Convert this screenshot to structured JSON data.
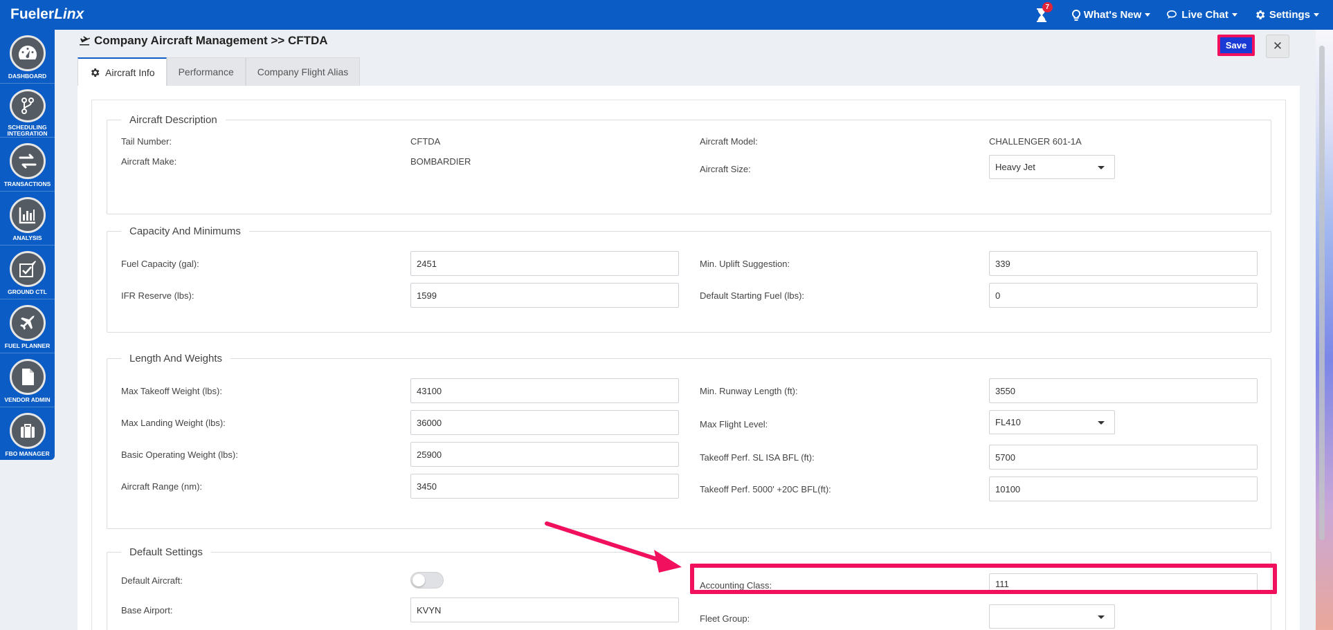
{
  "app": {
    "logo_main": "Fueler",
    "logo_italic": "Linx"
  },
  "topnav": {
    "notifications_count": "7",
    "whats_new": "What's New",
    "live_chat": "Live Chat",
    "settings": "Settings"
  },
  "sidebar": {
    "items": [
      {
        "label": "DASHBOARD",
        "icon": "gauge-icon"
      },
      {
        "label": "SCHEDULING INTEGRATION",
        "icon": "branch-icon"
      },
      {
        "label": "TRANSACTIONS",
        "icon": "exchange-icon"
      },
      {
        "label": "ANALYSIS",
        "icon": "bar-chart-icon"
      },
      {
        "label": "GROUND CTL",
        "icon": "checkbox-plane-icon"
      },
      {
        "label": "FUEL PLANNER",
        "icon": "plane-icon"
      },
      {
        "label": "VENDOR ADMIN",
        "icon": "document-icon"
      },
      {
        "label": "FBO MANAGER",
        "icon": "briefcase-icon"
      }
    ]
  },
  "page": {
    "title": "Company Aircraft Management >> CFTDA",
    "save_label": "Save",
    "close_label": "✕"
  },
  "tabs": [
    {
      "label": "Aircraft Info",
      "active": true
    },
    {
      "label": "Performance",
      "active": false
    },
    {
      "label": "Company Flight Alias",
      "active": false
    }
  ],
  "aircraft_description": {
    "legend": "Aircraft Description",
    "tail_number_label": "Tail Number:",
    "tail_number": "CFTDA",
    "make_label": "Aircraft Make:",
    "make": "BOMBARDIER",
    "model_label": "Aircraft Model:",
    "model": "CHALLENGER 601-1A",
    "size_label": "Aircraft Size:",
    "size": "Heavy Jet"
  },
  "capacity": {
    "legend": "Capacity And Minimums",
    "fuel_capacity_label": "Fuel Capacity (gal):",
    "fuel_capacity": "2451",
    "ifr_reserve_label": "IFR Reserve (lbs):",
    "ifr_reserve": "1599",
    "min_uplift_label": "Min. Uplift Suggestion:",
    "min_uplift": "339",
    "default_starting_fuel_label": "Default Starting Fuel (lbs):",
    "default_starting_fuel": "0"
  },
  "weights": {
    "legend": "Length And Weights",
    "max_takeoff_label": "Max Takeoff Weight (lbs):",
    "max_takeoff": "43100",
    "max_landing_label": "Max Landing Weight (lbs):",
    "max_landing": "36000",
    "basic_operating_label": "Basic Operating Weight (lbs):",
    "basic_operating": "25900",
    "range_label": "Aircraft Range (nm):",
    "range": "3450",
    "min_runway_label": "Min. Runway Length (ft):",
    "min_runway": "3550",
    "max_flight_level_label": "Max Flight Level:",
    "max_flight_level": "FL410",
    "takeoff_sl_label": "Takeoff Perf. SL ISA BFL (ft):",
    "takeoff_sl": "5700",
    "takeoff_5000_label": "Takeoff Perf. 5000' +20C BFL(ft):",
    "takeoff_5000": "10100"
  },
  "defaults": {
    "legend": "Default Settings",
    "default_aircraft_label": "Default Aircraft:",
    "default_aircraft_on": false,
    "base_airport_label": "Base Airport:",
    "base_airport": "KVYN",
    "accounting_class_label": "Accounting Class:",
    "accounting_class": "111",
    "fleet_group_label": "Fleet Group:",
    "fleet_group": ""
  },
  "colors": {
    "brand_blue": "#0b5cc4",
    "annotation_pink": "#f0105e",
    "save_blue": "#1a3ad6"
  }
}
